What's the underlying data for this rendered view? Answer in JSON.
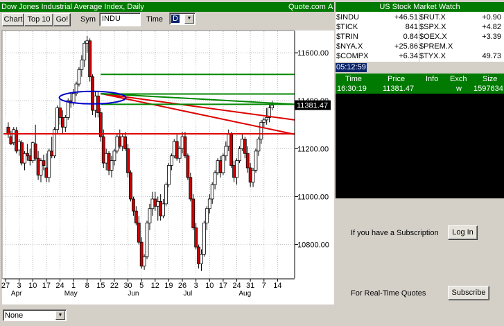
{
  "header": {
    "title": "Dow Jones Industrial Average Index, Daily",
    "source": "Quote.com",
    "marker": "A"
  },
  "toolbar": {
    "chart_button": "Chart",
    "top10_button": "Top 10",
    "go_button": "Go!",
    "sym_label": "Sym",
    "sym_value": "INDU",
    "time_label": "Time",
    "time_value": "D"
  },
  "bottom": {
    "study_select": "None"
  },
  "market_watch": {
    "title": "US Stock Market Watch",
    "rows": [
      {
        "left_sym": "$INDU",
        "left_val": "+46.51",
        "right_sym": "$RUT.X",
        "right_val": "+0.90"
      },
      {
        "left_sym": "$TICK",
        "left_val": "841",
        "right_sym": "$SPX.X",
        "right_val": "+4.82"
      },
      {
        "left_sym": "$TRIN",
        "left_val": "0.84",
        "right_sym": "$OEX.X",
        "right_val": "+3.39"
      },
      {
        "left_sym": "$NYA.X",
        "left_val": "+25.86",
        "right_sym": "$PREM.X",
        "right_val": ""
      },
      {
        "left_sym": "$COMPX",
        "left_val": "+6.34",
        "right_sym": "$TYX.X",
        "right_val": "49.73"
      }
    ]
  },
  "clock": "05:12:59",
  "trades": {
    "headers": {
      "time": "Time",
      "price": "Price",
      "info": "Info",
      "exch": "Exch",
      "size": "Size"
    },
    "rows": [
      {
        "time": "16:30:19",
        "price": "11381.47",
        "info": "",
        "exch": "w",
        "size": "1597634"
      }
    ]
  },
  "subscription": {
    "sub_text": "If you have a Subscription",
    "login_button": "Log In",
    "rt_text": "For Real-Time Quotes",
    "subscribe_button": "Subscribe"
  },
  "colors": {
    "up": "#ffffff",
    "down": "#cc0000",
    "red_line": "#dd0000",
    "green_line": "#008800",
    "ellipse": "#0000cc",
    "title_bg": "#007a00"
  },
  "chart_data": {
    "type": "candlestick",
    "title": "Dow Jones Industrial Average Index, Daily",
    "ylim": [
      10660,
      11690
    ],
    "y_ticks": [
      10800,
      11000,
      11200,
      11400,
      11600
    ],
    "y_tick_labels": [
      "10800.00",
      "11000.00",
      "11200.00",
      "11400.00",
      "11600.00"
    ],
    "last_price": 11381.47,
    "last_price_label": "11381.47",
    "x_day_labels": [
      "27",
      "3",
      "10",
      "17",
      "24",
      "1",
      "8",
      "15",
      "22",
      "30",
      "5",
      "12",
      "19",
      "26",
      "3",
      "10",
      "17",
      "24",
      "31",
      "7",
      "14"
    ],
    "x_day_index": [
      0,
      5,
      10,
      15,
      20,
      25,
      30,
      35,
      40,
      45,
      50,
      55,
      60,
      65,
      70,
      75,
      80,
      85,
      90,
      95,
      100
    ],
    "x_month_labels": [
      "Apr",
      "May",
      "Jun",
      "Jul",
      "Aug"
    ],
    "x_month_index": [
      4,
      24,
      47,
      67,
      88
    ],
    "n_days": 106,
    "grid": true,
    "candles": [
      [
        11290,
        11310,
        11245,
        11260
      ],
      [
        11250,
        11275,
        11215,
        11220
      ],
      [
        11225,
        11290,
        11215,
        11280
      ],
      [
        11275,
        11290,
        11180,
        11190
      ],
      [
        11195,
        11240,
        11170,
        11230
      ],
      [
        11225,
        11235,
        11130,
        11140
      ],
      [
        11140,
        11190,
        11110,
        11180
      ],
      [
        11180,
        11220,
        11150,
        11170
      ],
      [
        11170,
        11200,
        11130,
        11150
      ],
      [
        11150,
        11230,
        11140,
        11225
      ],
      [
        11220,
        11300,
        11150,
        11160
      ],
      [
        11160,
        11190,
        11070,
        11090
      ],
      [
        11090,
        11160,
        11060,
        11150
      ],
      [
        11150,
        11175,
        11110,
        11130
      ],
      [
        11120,
        11180,
        11060,
        11080
      ],
      [
        11080,
        11200,
        11060,
        11190
      ],
      [
        11190,
        11250,
        11160,
        11170
      ],
      [
        11170,
        11290,
        11160,
        11280
      ],
      [
        11280,
        11380,
        11260,
        11370
      ],
      [
        11370,
        11410,
        11300,
        11330
      ],
      [
        11330,
        11360,
        11260,
        11290
      ],
      [
        11290,
        11340,
        11270,
        11330
      ],
      [
        11330,
        11410,
        11320,
        11400
      ],
      [
        11400,
        11430,
        11370,
        11390
      ],
      [
        11390,
        11450,
        11380,
        11430
      ],
      [
        11430,
        11480,
        11420,
        11470
      ],
      [
        11470,
        11540,
        11460,
        11530
      ],
      [
        11530,
        11590,
        11500,
        11570
      ],
      [
        11570,
        11650,
        11540,
        11640
      ],
      [
        11640,
        11670,
        11600,
        11650
      ],
      [
        11650,
        11660,
        11480,
        11500
      ],
      [
        11500,
        11510,
        11340,
        11360
      ],
      [
        11360,
        11440,
        11330,
        11420
      ],
      [
        11420,
        11440,
        11330,
        11350
      ],
      [
        11350,
        11370,
        11230,
        11250
      ],
      [
        11250,
        11280,
        11120,
        11140
      ],
      [
        11140,
        11200,
        11110,
        11180
      ],
      [
        11180,
        11190,
        11090,
        11110
      ],
      [
        11110,
        11170,
        11080,
        11150
      ],
      [
        11150,
        11200,
        11130,
        11190
      ],
      [
        11190,
        11260,
        11180,
        11250
      ],
      [
        11250,
        11280,
        11200,
        11210
      ],
      [
        11210,
        11260,
        11190,
        11250
      ],
      [
        11250,
        11270,
        11190,
        11200
      ],
      [
        11200,
        11220,
        11080,
        11100
      ],
      [
        11100,
        11110,
        10980,
        10990
      ],
      [
        10990,
        11000,
        10920,
        10940
      ],
      [
        10940,
        10960,
        10880,
        10890
      ],
      [
        10890,
        10920,
        10800,
        10810
      ],
      [
        10810,
        10830,
        10700,
        10710
      ],
      [
        10710,
        10760,
        10695,
        10750
      ],
      [
        10750,
        10900,
        10740,
        10890
      ],
      [
        10890,
        10970,
        10860,
        10950
      ],
      [
        10950,
        11020,
        10920,
        10990
      ],
      [
        10990,
        11020,
        10940,
        10960
      ],
      [
        10960,
        11000,
        10900,
        10980
      ],
      [
        10980,
        11010,
        10900,
        10920
      ],
      [
        10920,
        10990,
        10910,
        10970
      ],
      [
        10970,
        11060,
        10960,
        11050
      ],
      [
        11050,
        11140,
        11040,
        11130
      ],
      [
        11130,
        11180,
        11110,
        11170
      ],
      [
        11170,
        11240,
        11160,
        11230
      ],
      [
        11230,
        11260,
        11150,
        11160
      ],
      [
        11160,
        11210,
        11140,
        11200
      ],
      [
        11200,
        11270,
        11180,
        11250
      ],
      [
        11250,
        11270,
        11160,
        11170
      ],
      [
        11170,
        11180,
        11070,
        11080
      ],
      [
        11080,
        11100,
        10980,
        10990
      ],
      [
        10990,
        11010,
        10860,
        10870
      ],
      [
        10870,
        10890,
        10780,
        10790
      ],
      [
        10790,
        10800,
        10700,
        10720
      ],
      [
        10720,
        10780,
        10690,
        10760
      ],
      [
        10760,
        10900,
        10750,
        10890
      ],
      [
        10890,
        10960,
        10860,
        10950
      ],
      [
        10950,
        11010,
        10930,
        10990
      ],
      [
        10990,
        11060,
        10970,
        11050
      ],
      [
        11050,
        11110,
        11030,
        11100
      ],
      [
        11100,
        11160,
        11090,
        11150
      ],
      [
        11150,
        11170,
        11080,
        11100
      ],
      [
        11100,
        11180,
        11090,
        11170
      ],
      [
        11170,
        11230,
        11150,
        11210
      ],
      [
        11210,
        11280,
        11190,
        11260
      ],
      [
        11260,
        11270,
        11120,
        11130
      ],
      [
        11130,
        11150,
        11060,
        11080
      ],
      [
        11080,
        11160,
        11050,
        11150
      ],
      [
        11150,
        11210,
        11140,
        11200
      ],
      [
        11200,
        11260,
        11190,
        11240
      ],
      [
        11240,
        11250,
        11160,
        11180
      ],
      [
        11180,
        11210,
        11100,
        11120
      ],
      [
        11120,
        11140,
        11040,
        11060
      ],
      [
        11060,
        11120,
        11040,
        11110
      ],
      [
        11110,
        11200,
        11100,
        11190
      ],
      [
        11190,
        11250,
        11170,
        11240
      ],
      [
        11240,
        11320,
        11220,
        11310
      ],
      [
        11310,
        11330,
        11290,
        11320
      ],
      [
        11320,
        11370,
        11300,
        11330
      ],
      [
        11330,
        11390,
        11310,
        11370
      ],
      [
        11370,
        11400,
        11360,
        11381
      ]
    ],
    "n_candles_shown": 98,
    "lines": [
      {
        "kind": "horizontal",
        "color": "red",
        "y": 11262
      },
      {
        "kind": "trend",
        "color": "red",
        "from": [
          34,
          11430
        ],
        "to": [
          105,
          11320
        ]
      },
      {
        "kind": "trend",
        "color": "red",
        "from": [
          34,
          11430
        ],
        "to": [
          105,
          11260
        ]
      },
      {
        "kind": "horizontal",
        "color": "green",
        "y": 11510,
        "x_from": 34
      },
      {
        "kind": "horizontal",
        "color": "green",
        "y": 11428,
        "x_from": 34
      },
      {
        "kind": "horizontal",
        "color": "green",
        "y": 11385,
        "x_from": 34
      },
      {
        "kind": "trend",
        "color": "green",
        "from": [
          34,
          11430
        ],
        "to": [
          105,
          11385
        ]
      }
    ],
    "ellipse": {
      "cx": 31,
      "cy": 11413,
      "rx_days": 12,
      "ry_units": 25
    }
  }
}
